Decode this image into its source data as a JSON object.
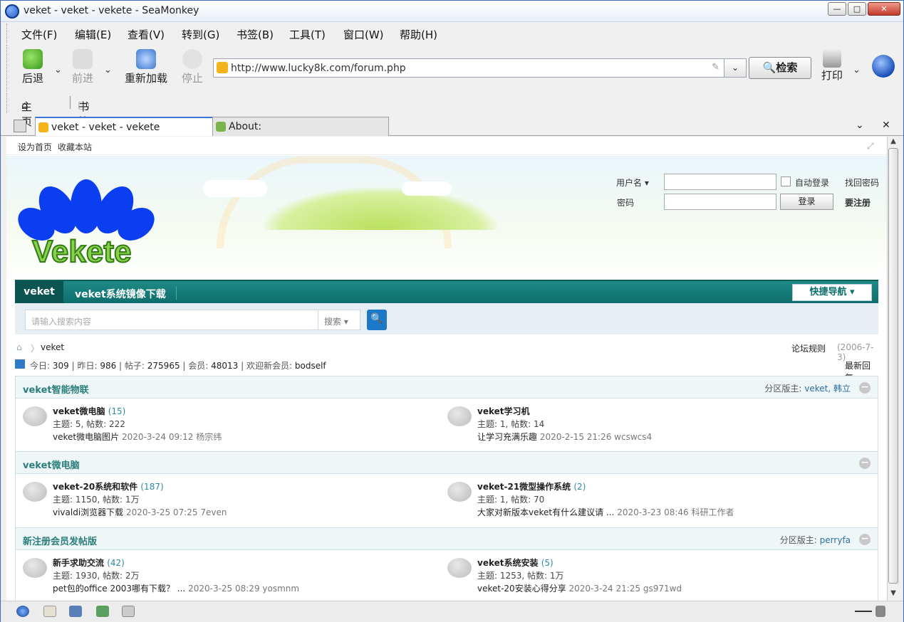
{
  "window": {
    "title": "veket - veket - vekete - SeaMonkey"
  },
  "menu": [
    "文件(F)",
    "编辑(E)",
    "查看(V)",
    "转到(G)",
    "书签(B)",
    "工具(T)",
    "窗口(W)",
    "帮助(H)"
  ],
  "nav": {
    "back": "后退",
    "forward": "前进",
    "reload": "重新加载",
    "stop": "停止",
    "search": "检索",
    "print": "打印"
  },
  "address": {
    "url": "http://www.lucky8k.com/forum.php"
  },
  "personal": {
    "home": "主页",
    "bookmarks": "书签"
  },
  "tabs": [
    {
      "label": "veket - veket - vekete"
    },
    {
      "label": "About:"
    }
  ],
  "page": {
    "top_links": [
      "设为首页",
      "收藏本站"
    ],
    "logo": "Vekete",
    "login": {
      "username_label": "用户名",
      "password_label": "密码",
      "auto_login": "自动登录",
      "find_password": "找回密码",
      "login_button": "登录",
      "register": "要注册"
    },
    "navbar": {
      "items": [
        "veket",
        "veket系统镜像下载"
      ],
      "quick": "快捷导航"
    },
    "search": {
      "placeholder": "请输入搜索内容",
      "type": "搜索"
    },
    "crumb": {
      "current": "veket",
      "rules": "论坛规则",
      "rules_date": "(2006-7-3)"
    },
    "stats": {
      "today_label": "今日:",
      "today": "309",
      "yesterday_label": "昨日:",
      "yesterday": "986",
      "posts_label": "帖子:",
      "posts": "275965",
      "members_label": "会员:",
      "members": "48013",
      "newest_label": "欢迎新会员:",
      "newest": "bodself",
      "latest_reply": "最新回复"
    },
    "sections": [
      {
        "title": "veket智能物联",
        "moderators_label": "分区版主:",
        "moderators": "veket, 韩立",
        "forums": [
          {
            "name": "veket微电脑",
            "count": "(15)",
            "meta": "主题: 5, 帖数: 222",
            "last_title": "veket微电脑图片",
            "last_info": "2020-3-24 09:12 杨宗纬"
          },
          {
            "name": "veket学习机",
            "count": "",
            "meta": "主题: 1, 帖数: 14",
            "last_title": "让学习充满乐趣",
            "last_info": "2020-2-15 21:26 wcswcs4"
          }
        ]
      },
      {
        "title": "veket微电脑",
        "moderators_label": "",
        "moderators": "",
        "forums": [
          {
            "name": "veket-20系统和软件",
            "count": "(187)",
            "meta": "主题: 1150, 帖数: 1万",
            "last_title": "vivaldi浏览器下载",
            "last_info": "2020-3-25 07:25 7even"
          },
          {
            "name": "veket-21微型操作系统",
            "count": "(2)",
            "meta": "主题: 1, 帖数: 70",
            "last_title": "大家对新版本veket有什么建议请 ...",
            "last_info": "2020-3-23 08:46 科研工作者"
          }
        ]
      },
      {
        "title": "新注册会员发帖版",
        "moderators_label": "分区版主:",
        "moderators": "perryfa",
        "forums": [
          {
            "name": "新手求助交流",
            "count": "(42)",
            "meta": "主题: 1930, 帖数: 2万",
            "last_title": "pet包的office 2003哪有下载？ ...",
            "last_info": "2020-3-25 08:29 yosmnm"
          },
          {
            "name": "veket系统安装",
            "count": "(5)",
            "meta": "主题: 1253, 帖数: 1万",
            "last_title": "veket-20安装心得分享",
            "last_info": "2020-3-24 21:25 gs971wd"
          }
        ]
      }
    ]
  },
  "colors": {
    "accent": "#0e6e6b",
    "link": "#2c6fa1",
    "window_border": "#3d6cc2"
  }
}
